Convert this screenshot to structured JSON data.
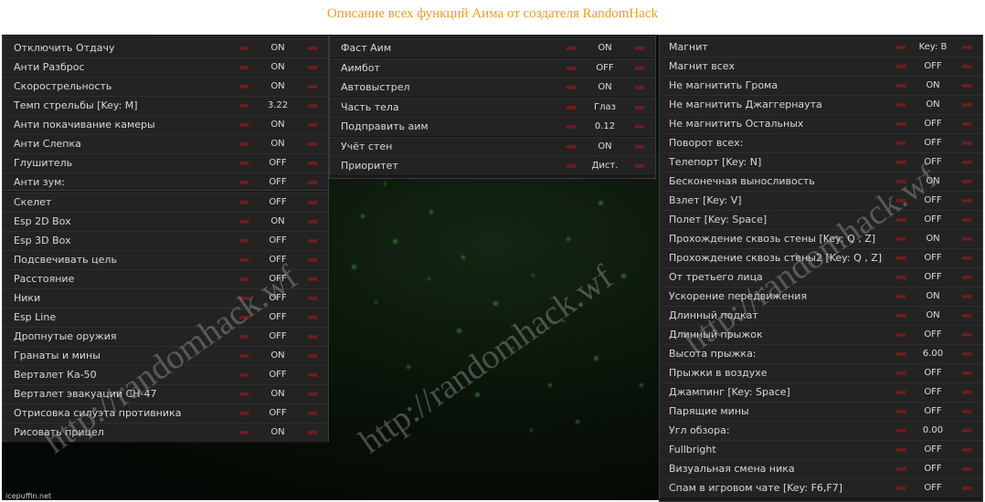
{
  "title": "Описание всех функций Аима от создателя RandomHack",
  "watermark": "http://randomhack.wf",
  "corner_text": "icepuffin.net",
  "arrow_glyph": "«",
  "colors": {
    "title": "#e3a02a",
    "arrow": "#a11a1a",
    "panel": "#232323"
  },
  "panel_left_top": [
    {
      "label": "Отключить Отдачу",
      "value": "ON"
    },
    {
      "label": "Анти Разброс",
      "value": "ON"
    },
    {
      "label": "Скорострельность",
      "value": "ON"
    },
    {
      "label": "Темп стрельбы [Key: M]",
      "value": "3.22"
    },
    {
      "label": "Анти покачивание камеры",
      "value": "ON"
    },
    {
      "label": "Анти Слепка",
      "value": "ON"
    },
    {
      "label": "Глушитель",
      "value": "OFF"
    },
    {
      "label": "Анти зум:",
      "value": "OFF"
    }
  ],
  "panel_left_bottom": [
    {
      "label": "Скелет",
      "value": "OFF"
    },
    {
      "label": "Esp 2D Box",
      "value": "ON"
    },
    {
      "label": "Esp 3D Box",
      "value": "OFF"
    },
    {
      "label": "Подсвечивать цель",
      "value": "OFF"
    },
    {
      "label": "Расстояние",
      "value": "OFF"
    },
    {
      "label": "Ники",
      "value": "OFF"
    },
    {
      "label": "Esp Line",
      "value": "OFF"
    },
    {
      "label": "Дропнутые оружия",
      "value": "OFF"
    },
    {
      "label": "Гранаты и мины",
      "value": "ON"
    },
    {
      "label": "Верталет Ка-50",
      "value": "OFF"
    },
    {
      "label": "Верталет эвакуации CH-47",
      "value": "ON"
    },
    {
      "label": "Отрисовка силуэта противника",
      "value": "OFF"
    },
    {
      "label": "Рисовать прицел",
      "value": "ON"
    }
  ],
  "panel_middle": [
    {
      "label": "Фаст Аим",
      "value": "ON"
    },
    {
      "label": "Аимбот",
      "value": "OFF"
    },
    {
      "label": "Автовыстрел",
      "value": "ON"
    },
    {
      "label": "Часть тела",
      "value": "Глаз"
    },
    {
      "label": "Подправить аим",
      "value": "0.12"
    },
    {
      "label": "Учёт стен",
      "value": "ON"
    },
    {
      "label": "Приоритет",
      "value": "Дист."
    }
  ],
  "panel_right": [
    {
      "label": "Магнит",
      "value": "Key: B"
    },
    {
      "label": "Магнит всех",
      "value": "OFF"
    },
    {
      "label": "Не магнитить Грома",
      "value": "ON"
    },
    {
      "label": "Не магнитить Джаггернаута",
      "value": "ON"
    },
    {
      "label": "Не магнитить Остальных",
      "value": "OFF"
    },
    {
      "label": "Поворот всех:",
      "value": "OFF"
    },
    {
      "label": "Телепорт [Key: N]",
      "value": "OFF"
    },
    {
      "label": "Бесконечная выносливость",
      "value": "ON"
    },
    {
      "label": "Взлет [Key: V]",
      "value": "OFF"
    },
    {
      "label": "Полет [Key: Space]",
      "value": "OFF"
    },
    {
      "label": "Прохождение сквозь стены [Key: Q , Z]",
      "value": "ON"
    },
    {
      "label": "Прохождение сквозь стены2 [Key: Q , Z]",
      "value": "OFF"
    },
    {
      "label": "От третьего лица",
      "value": "OFF"
    },
    {
      "label": "Ускорение передвижения",
      "value": "ON"
    },
    {
      "label": "Длинный подкат",
      "value": "ON"
    },
    {
      "label": "Длинный прыжок",
      "value": "OFF"
    },
    {
      "label": "Высота прыжка:",
      "value": "6.00"
    },
    {
      "label": "Прыжки в воздухе",
      "value": "OFF"
    },
    {
      "label": "Джампинг [Key: Space]",
      "value": "OFF"
    },
    {
      "label": "Парящие мины",
      "value": "OFF"
    },
    {
      "label": "Угл обзора:",
      "value": "0.00"
    },
    {
      "label": "Fullbright",
      "value": "OFF"
    },
    {
      "label": "Визуальная смена ника",
      "value": "OFF"
    },
    {
      "label": "Спам в игровом чате [Key: F6,F7]",
      "value": "OFF"
    }
  ]
}
